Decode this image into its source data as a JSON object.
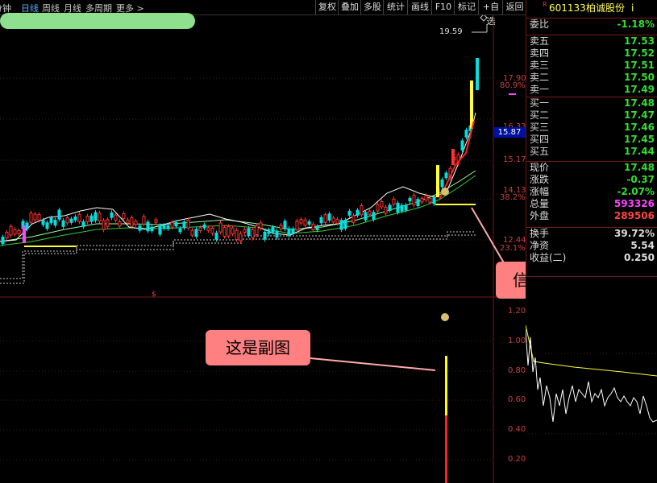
{
  "toolbar": {
    "period_tabs": [
      "分钟",
      "日线",
      "周线",
      "月线",
      "多周期",
      "更多 >"
    ],
    "active_tab": "日线",
    "right_buttons": [
      "复权",
      "叠加",
      "多股",
      "统计",
      "画线",
      "F10",
      "标记",
      "+自选",
      "返回"
    ]
  },
  "main_chart": {
    "price_labels": [
      {
        "text": "17.90",
        "kind": "price"
      },
      {
        "text": "80.9%",
        "kind": "pct"
      },
      {
        "text": "16.33",
        "kind": "price"
      },
      {
        "text": "15.87",
        "kind": "current"
      },
      {
        "text": "15.17",
        "kind": "price"
      },
      {
        "text": "14.13",
        "kind": "price"
      },
      {
        "text": "38.2%",
        "kind": "pct"
      },
      {
        "text": "12.44",
        "kind": "price"
      },
      {
        "text": "23.1%",
        "kind": "pct"
      }
    ],
    "high_marker": "19.59",
    "callout_signal": "信号",
    "callout_sub": "这是副图",
    "colors": {
      "up": "#ff3333",
      "down": "#00e0e0",
      "ma_white": "#ffffff",
      "ma_yellow": "#ffff00",
      "ma_green": "#33cc33",
      "signal": "#ffff33"
    }
  },
  "sub_chart": {
    "y_labels": [
      "1.20",
      "1.00",
      "0.80",
      "0.60",
      "0.40",
      "0.20"
    ]
  },
  "quote": {
    "code": "601133",
    "name": "柏诚股份",
    "suffix": "i",
    "rows": [
      {
        "label": "委比",
        "value": "-1.18%",
        "color": "#33dd33"
      },
      {
        "label": "卖五",
        "value": "17.53",
        "color": "#33dd33"
      },
      {
        "label": "卖四",
        "value": "17.52",
        "color": "#33dd33"
      },
      {
        "label": "卖三",
        "value": "17.51",
        "color": "#33dd33"
      },
      {
        "label": "卖二",
        "value": "17.50",
        "color": "#33dd33"
      },
      {
        "label": "卖一",
        "value": "17.49",
        "color": "#33dd33"
      },
      {
        "label": "买一",
        "value": "17.48",
        "color": "#33dd33"
      },
      {
        "label": "买二",
        "value": "17.47",
        "color": "#33dd33"
      },
      {
        "label": "买三",
        "value": "17.46",
        "color": "#33dd33"
      },
      {
        "label": "买四",
        "value": "17.45",
        "color": "#33dd33"
      },
      {
        "label": "买五",
        "value": "17.44",
        "color": "#33dd33"
      },
      {
        "label": "现价",
        "value": "17.48",
        "color": "#33dd33"
      },
      {
        "label": "涨跌",
        "value": "-0.37",
        "color": "#33dd33"
      },
      {
        "label": "涨幅",
        "value": "-2.07%",
        "color": "#33dd33"
      },
      {
        "label": "总量",
        "value": "593326",
        "color": "#ff44ff"
      },
      {
        "label": "外盘",
        "value": "289506",
        "color": "#ff4444"
      },
      {
        "label": "换手",
        "value": "39.72%",
        "color": "#dddddd"
      },
      {
        "label": "净资",
        "value": "5.54",
        "color": "#dddddd"
      },
      {
        "label": "收益(二)",
        "value": "0.250",
        "color": "#dddddd"
      }
    ]
  }
}
